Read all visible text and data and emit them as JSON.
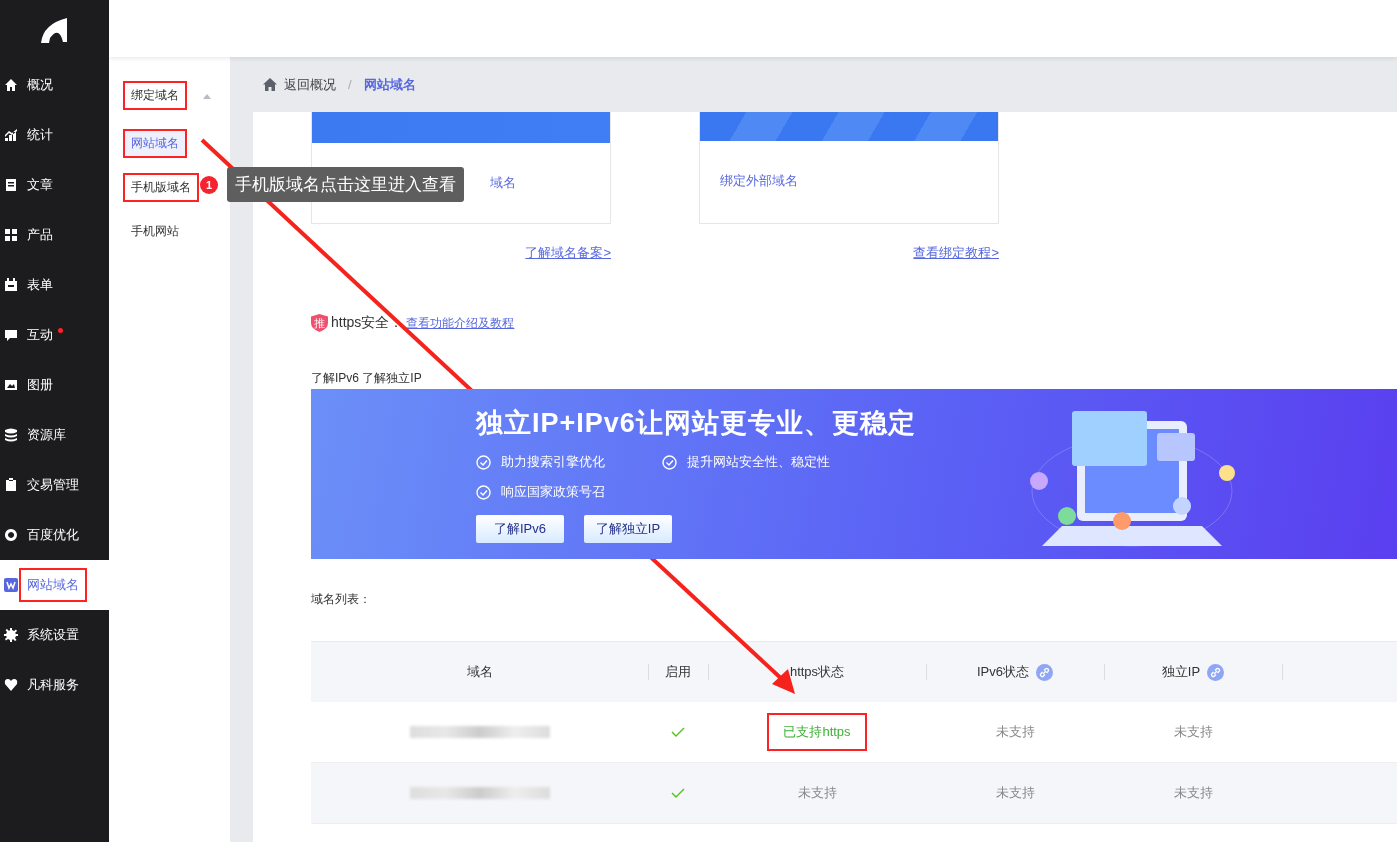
{
  "sidebar": {
    "items": [
      {
        "label": "概况",
        "selected": false,
        "badge": false,
        "highlighted": false
      },
      {
        "label": "统计",
        "selected": false,
        "badge": false,
        "highlighted": false
      },
      {
        "label": "文章",
        "selected": false,
        "badge": false,
        "highlighted": false
      },
      {
        "label": "产品",
        "selected": false,
        "badge": false,
        "highlighted": false
      },
      {
        "label": "表单",
        "selected": false,
        "badge": false,
        "highlighted": false
      },
      {
        "label": "互动",
        "selected": false,
        "badge": true,
        "highlighted": false
      },
      {
        "label": "图册",
        "selected": false,
        "badge": false,
        "highlighted": false
      },
      {
        "label": "资源库",
        "selected": false,
        "badge": false,
        "highlighted": false
      },
      {
        "label": "交易管理",
        "selected": false,
        "badge": false,
        "highlighted": false
      },
      {
        "label": "百度优化",
        "selected": false,
        "badge": false,
        "highlighted": false
      },
      {
        "label": "网站域名",
        "selected": true,
        "badge": false,
        "highlighted": true
      },
      {
        "label": "系统设置",
        "selected": false,
        "badge": false,
        "highlighted": false
      },
      {
        "label": "凡科服务",
        "selected": false,
        "badge": false,
        "highlighted": false
      }
    ]
  },
  "submenu": {
    "group": {
      "label": "绑定域名",
      "expanded": true,
      "highlighted": true
    },
    "items": [
      {
        "label": "网站域名",
        "selected": true,
        "highlighted": true
      },
      {
        "label": "手机版域名",
        "selected": false,
        "highlighted": true
      },
      {
        "label": "手机网站",
        "selected": false,
        "highlighted": false
      }
    ]
  },
  "breadcrumb": {
    "back": "返回概况",
    "separator": "/",
    "current": "网站域名"
  },
  "cards": [
    {
      "label": "域名",
      "link": "了解域名备案>"
    },
    {
      "label": "绑定外部域名",
      "link": "查看绑定教程>"
    }
  ],
  "https": {
    "badge": "推",
    "label": "https安全：",
    "link": "查看功能介绍及教程"
  },
  "banner": {
    "caption": "了解IPv6 了解独立IP",
    "title": "独立IP+IPv6让网站更专业、更稳定",
    "features": [
      "助力搜索引擎优化",
      "提升网站安全性、稳定性",
      "响应国家政策号召"
    ],
    "buttons": [
      "了解IPv6",
      "了解独立IP"
    ]
  },
  "table": {
    "title": "域名列表：",
    "columns": [
      {
        "label": "域名",
        "kind": "plain"
      },
      {
        "label": "启用",
        "kind": "plain"
      },
      {
        "label": "https状态",
        "kind": "plain"
      },
      {
        "label": "IPv6状态",
        "kind": "link"
      },
      {
        "label": "独立IP",
        "kind": "link"
      }
    ],
    "rows": [
      {
        "enabled": true,
        "https": {
          "text": "已支持https",
          "supported": true,
          "highlighted": true
        },
        "ipv6": "未支持",
        "ip": "未支持"
      },
      {
        "enabled": true,
        "https": {
          "text": "未支持",
          "supported": false,
          "highlighted": false
        },
        "ipv6": "未支持",
        "ip": "未支持"
      }
    ]
  },
  "tooltip": {
    "number": "1",
    "text": "手机版域名点击这里进入查看"
  }
}
